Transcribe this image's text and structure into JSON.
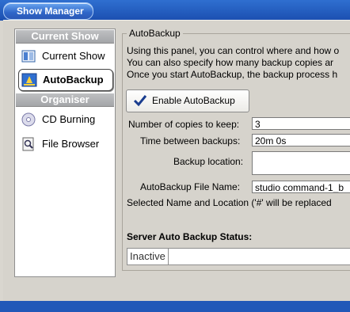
{
  "window": {
    "title": "Show Manager"
  },
  "sidebar": {
    "sections": [
      {
        "heading": "Current Show"
      },
      {
        "heading": "Organiser"
      }
    ],
    "items": [
      {
        "label": "Current Show",
        "icon": "current-show-icon"
      },
      {
        "label": "AutoBackup",
        "icon": "autobackup-icon",
        "active": true
      },
      {
        "label": "CD Burning",
        "icon": "cd-icon"
      },
      {
        "label": "File Browser",
        "icon": "file-browser-icon"
      }
    ]
  },
  "panel": {
    "group_title": "AutoBackup",
    "description": [
      "Using this panel, you can control where and how o",
      "You can also specify how many backup copies ar",
      "Once you start AutoBackup, the backup process h"
    ],
    "enable_button": "Enable AutoBackup",
    "fields": {
      "copies_label": "Number of copies to keep:",
      "copies_value": "3",
      "interval_label": "Time between backups:",
      "interval_value": "20m 0s",
      "location_label": "Backup location:",
      "location_value": "",
      "filename_label": "AutoBackup File Name:",
      "filename_value": "studio command-1_b"
    },
    "note": "Selected Name and Location ('#' will be replaced",
    "status_title": "Server Auto Backup Status:",
    "status_value": "Inactive"
  },
  "colors": {
    "title_bar": "#1b4fb0",
    "panel_bg": "#d6d3cc",
    "sidebar_head": "#a3a5a8"
  }
}
